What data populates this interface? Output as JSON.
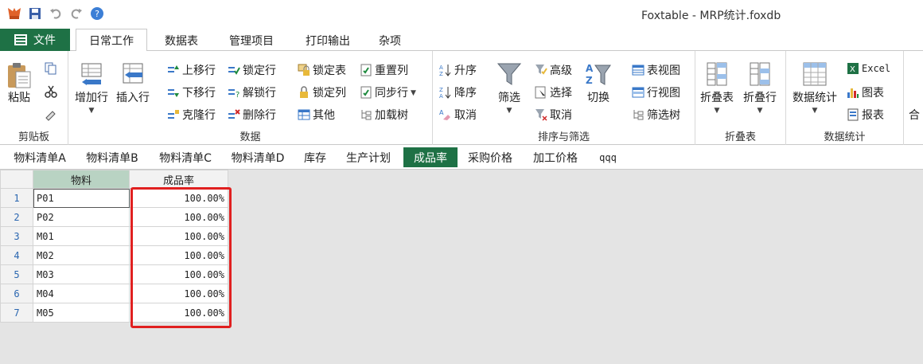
{
  "window": {
    "title": "Foxtable - MRP统计.foxdb"
  },
  "ribbon_tabs": {
    "file": "文件",
    "tabs": [
      "日常工作",
      "数据表",
      "管理项目",
      "打印输出",
      "杂项"
    ]
  },
  "groups": {
    "clipboard": {
      "label": "剪贴板",
      "paste": "粘贴"
    },
    "data": {
      "label": "数据",
      "add_row": "增加行",
      "insert_row": "插入行",
      "move_up": "上移行",
      "move_down": "下移行",
      "clone_row": "克隆行",
      "lock_row": "锁定行",
      "unlock_row": "解锁行",
      "delete_row": "删除行",
      "lock_table": "锁定表",
      "lock_col": "锁定列",
      "other": "其他",
      "reset_col": "重置列",
      "sync_row": "同步行",
      "load_tree": "加载树"
    },
    "sort_filter": {
      "label": "排序与筛选",
      "asc": "升序",
      "desc": "降序",
      "cancel_sort": "取消",
      "filter": "筛选",
      "advanced": "高级",
      "select": "选择",
      "cancel_filter": "取消",
      "toggle": "切换",
      "table_view": "表视图",
      "row_view": "行视图",
      "filter_tree": "筛选树"
    },
    "fold": {
      "label": "折叠表",
      "fold_table": "折叠表",
      "fold_row": "折叠行"
    },
    "stats": {
      "label": "数据统计",
      "stats": "数据统计",
      "excel": "Excel",
      "chart": "图表",
      "report": "报表"
    },
    "extra": {
      "label": "合"
    }
  },
  "sheet_tabs": [
    "物料清单A",
    "物料清单B",
    "物料清单C",
    "物料清单D",
    "库存",
    "生产计划",
    "成品率",
    "采购价格",
    "加工价格",
    "qqq"
  ],
  "active_sheet": "成品率",
  "grid": {
    "columns": [
      "物料",
      "成品率"
    ],
    "rows": [
      {
        "n": "1",
        "material": "P01",
        "rate": "100.00%"
      },
      {
        "n": "2",
        "material": "P02",
        "rate": "100.00%"
      },
      {
        "n": "3",
        "material": "M01",
        "rate": "100.00%"
      },
      {
        "n": "4",
        "material": "M02",
        "rate": "100.00%"
      },
      {
        "n": "5",
        "material": "M03",
        "rate": "100.00%"
      },
      {
        "n": "6",
        "material": "M04",
        "rate": "100.00%"
      },
      {
        "n": "7",
        "material": "M05",
        "rate": "100.00%"
      }
    ]
  },
  "colors": {
    "accent": "#1e7145",
    "highlight": "#e02020",
    "row_number": "#2a66b0"
  }
}
